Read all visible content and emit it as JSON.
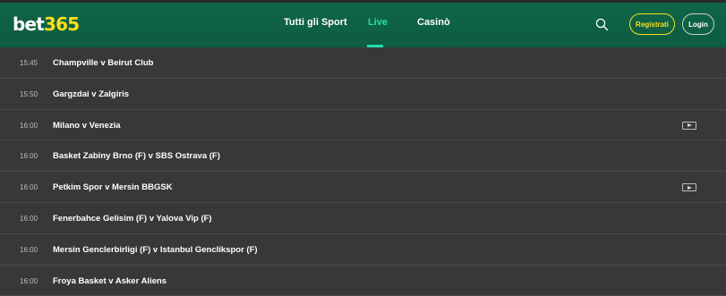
{
  "header": {
    "logo_bet": "bet",
    "logo_num": "365",
    "nav": [
      "Tutti gli Sport",
      "Live",
      "Casinò"
    ],
    "register_label": "Registrati",
    "login_label": "Login",
    "colors": {
      "bg": "#0e5d41",
      "accent": "#28dcaa",
      "brand_yellow": "#ffdf1b"
    }
  },
  "events": [
    {
      "time": "15:45",
      "match": "Champville v Beirut Club",
      "stream": false
    },
    {
      "time": "15:50",
      "match": "Gargzdai v Zalgiris",
      "stream": false
    },
    {
      "time": "16:00",
      "match": "Milano v Venezia",
      "stream": true
    },
    {
      "time": "16:00",
      "match": "Basket Zabiny Brno (F) v SBS Ostrava (F)",
      "stream": false
    },
    {
      "time": "16:00",
      "match": "Petkim Spor v Mersin BBGSK",
      "stream": true
    },
    {
      "time": "16:00",
      "match": "Fenerbahce Gelisim (F) v Yalova Vip (F)",
      "stream": false
    },
    {
      "time": "16:00",
      "match": "Mersin Genclerbirligi (F) v Istanbul Genclikspor (F)",
      "stream": false
    },
    {
      "time": "16:00",
      "match": "Froya Basket v Asker Aliens",
      "stream": false
    }
  ]
}
